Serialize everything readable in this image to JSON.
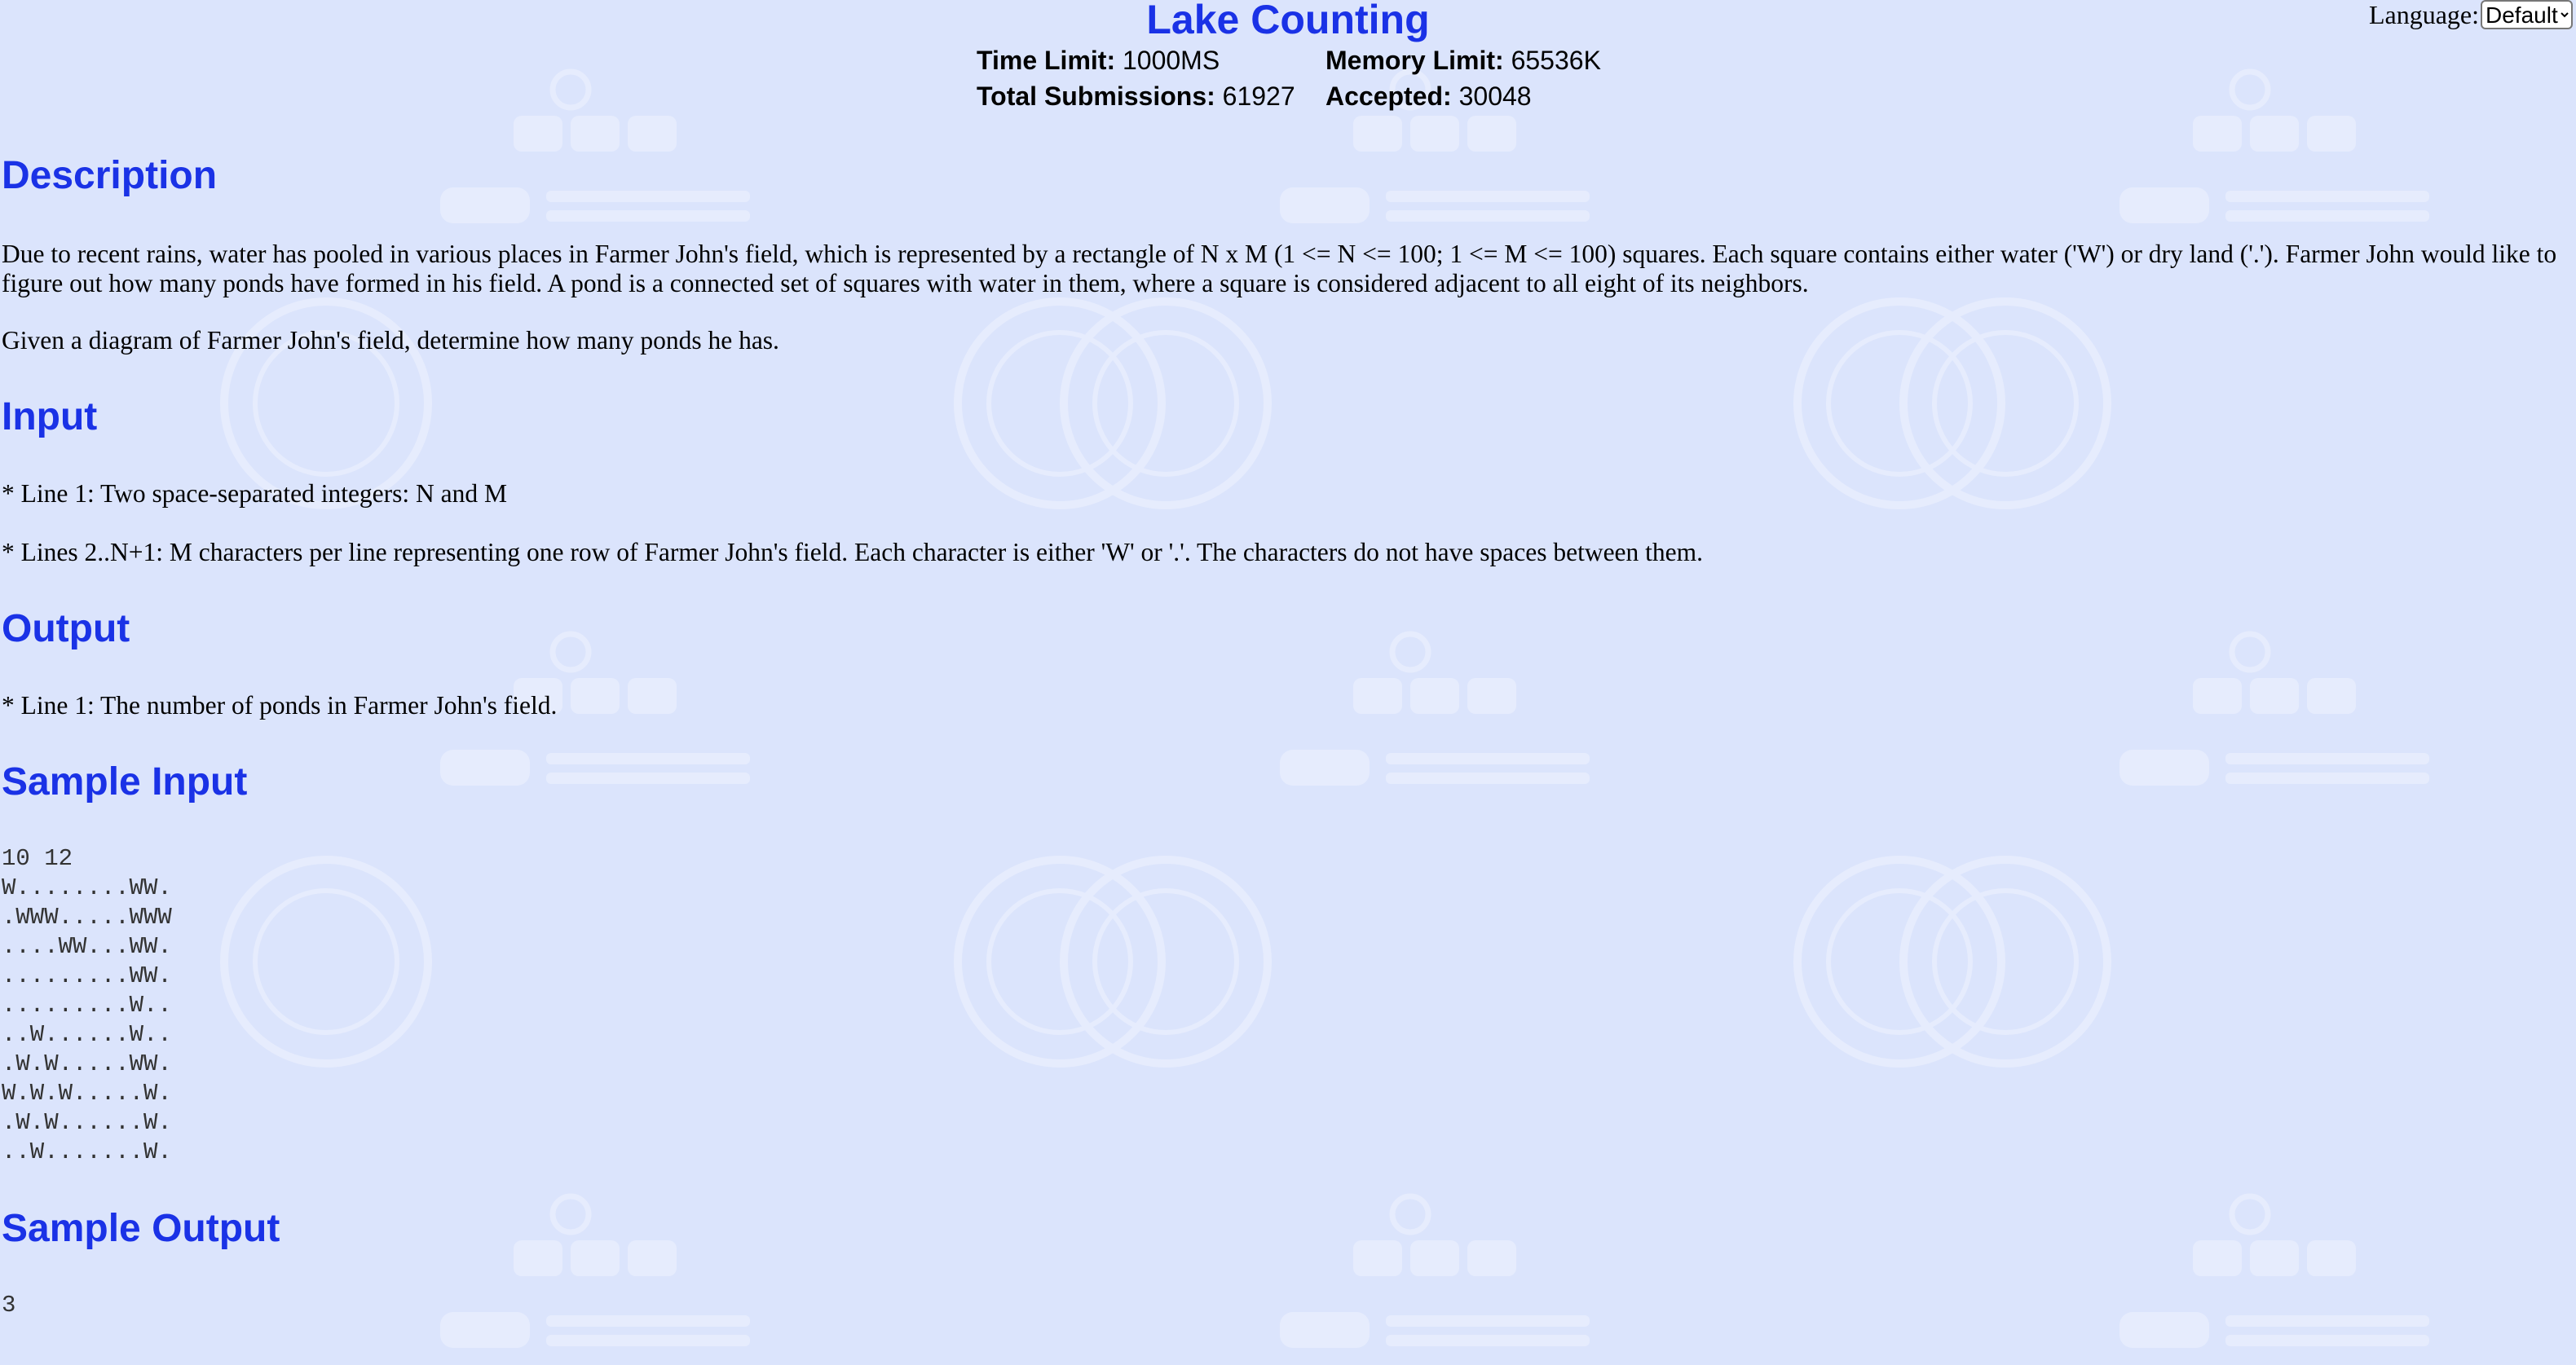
{
  "problem": {
    "title": "Lake Counting",
    "time_limit_label": "Time Limit:",
    "time_limit": "1000MS",
    "memory_limit_label": "Memory Limit:",
    "memory_limit": "65536K",
    "total_submissions_label": "Total Submissions:",
    "total_submissions": "61927",
    "accepted_label": "Accepted:",
    "accepted": "30048"
  },
  "language": {
    "label": "Language:",
    "selected": "Default"
  },
  "sections": {
    "description_title": "Description",
    "description_p1": "Due to recent rains, water has pooled in various places in Farmer John's field, which is represented by a rectangle of N x M (1 <= N <= 100; 1 <= M <= 100) squares. Each square contains either water ('W') or dry land ('.'). Farmer John would like to figure out how many ponds have formed in his field. A pond is a connected set of squares with water in them, where a square is considered adjacent to all eight of its neighbors.",
    "description_p2": "Given a diagram of Farmer John's field, determine how many ponds he has.",
    "input_title": "Input",
    "input_p1": "* Line 1: Two space-separated integers: N and M",
    "input_p2": "* Lines 2..N+1: M characters per line representing one row of Farmer John's field. Each character is either 'W' or '.'. The characters do not have spaces between them.",
    "output_title": "Output",
    "output_p1": "* Line 1: The number of ponds in Farmer John's field.",
    "sample_input_title": "Sample Input",
    "sample_input": "10 12\nW........WW.\n.WWW.....WWW\n....WW...WW.\n.........WW.\n.........W..\n..W......W..\n.W.W.....WW.\nW.W.W.....W.\n.W.W......W.\n..W.......W.",
    "sample_output_title": "Sample Output",
    "sample_output": "3"
  },
  "colors": {
    "background": "#dbe4fc",
    "heading": "#1a32e6"
  }
}
